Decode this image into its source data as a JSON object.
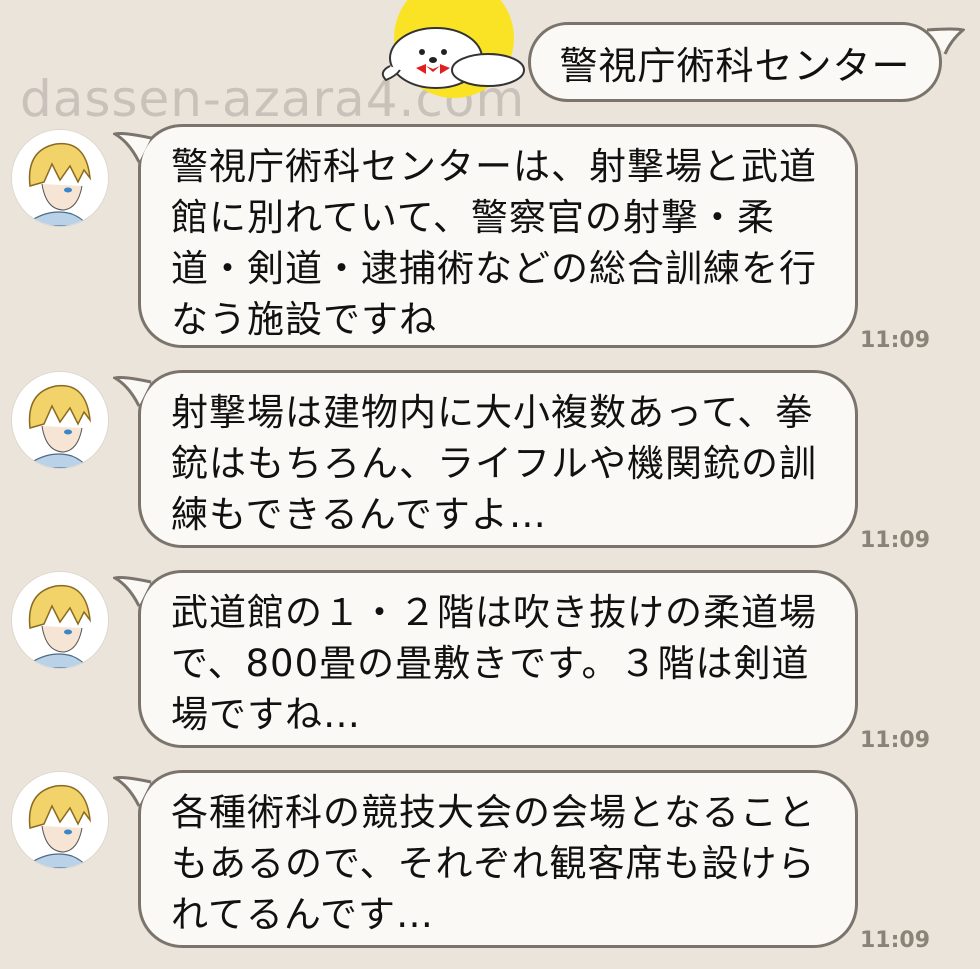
{
  "watermark": "dassen-azara4.com",
  "sent": {
    "text": "警視庁術科センター"
  },
  "messages": [
    {
      "text": "警視庁術科センターは、射撃場と武道館に別れていて、警察官の射撃・柔道・剣道・逮捕術などの総合訓練を行なう施設ですね",
      "time": "11:09"
    },
    {
      "text": "射撃場は建物内に大小複数あって、拳銃はもちろん、ライフルや機関銃の訓練もできるんですよ…",
      "time": "11:09"
    },
    {
      "text": "武道館の１・２階は吹き抜けの柔道場で、800畳の畳敷きです。３階は剣道場ですね…",
      "time": "11:09"
    },
    {
      "text": "各種術科の競技大会の会場となることもあるので、それぞれ観客席も設けられてるんです…",
      "time": "11:09"
    }
  ],
  "icons": {
    "avatar": "blond-anime-character-avatar",
    "mascot": "seal-mascot-with-bowtie"
  }
}
